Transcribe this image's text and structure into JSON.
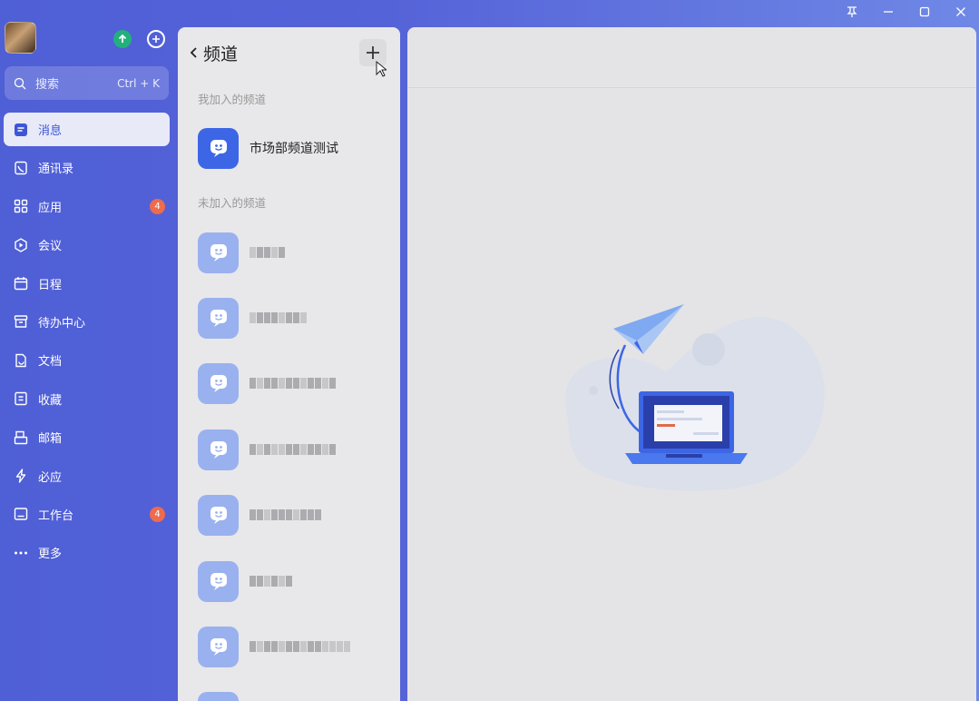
{
  "window": {
    "controls": [
      "pin",
      "minimize",
      "maximize",
      "close"
    ]
  },
  "search": {
    "placeholder": "搜索",
    "shortcut": "Ctrl + K"
  },
  "nav": {
    "items": [
      {
        "label": "消息",
        "icon": "message-icon",
        "active": true
      },
      {
        "label": "通讯录",
        "icon": "contacts-icon"
      },
      {
        "label": "应用",
        "icon": "apps-icon",
        "badge": "4"
      },
      {
        "label": "会议",
        "icon": "meeting-icon"
      },
      {
        "label": "日程",
        "icon": "calendar-icon"
      },
      {
        "label": "待办中心",
        "icon": "todo-icon"
      },
      {
        "label": "文档",
        "icon": "document-icon"
      },
      {
        "label": "收藏",
        "icon": "bookmark-icon"
      },
      {
        "label": "邮箱",
        "icon": "mail-icon"
      },
      {
        "label": "必应",
        "icon": "ding-icon"
      },
      {
        "label": "工作台",
        "icon": "workbench-icon",
        "badge": "4"
      },
      {
        "label": "更多",
        "icon": "more-icon"
      }
    ]
  },
  "panel": {
    "title": "频道",
    "joined_title": "我加入的频道",
    "unjoined_title": "未加入的频道",
    "joined": [
      {
        "name": "市场部频道测试"
      }
    ]
  },
  "colors": {
    "accent": "#3d66e6",
    "badge": "#ee6b4d",
    "sidebar": "#5563d8"
  }
}
